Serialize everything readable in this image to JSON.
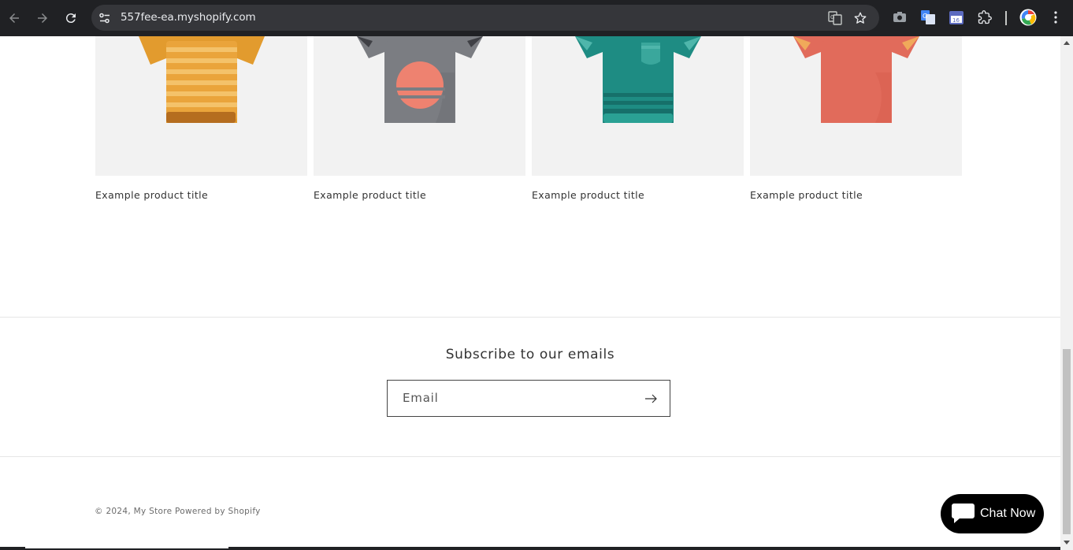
{
  "browser": {
    "url": "557fee-ea.myshopify.com"
  },
  "products": [
    {
      "title": "Example product title",
      "image": "orange-striped-tshirt"
    },
    {
      "title": "Example product title",
      "image": "gray-sunset-tshirt"
    },
    {
      "title": "Example product title",
      "image": "teal-polo-shirt"
    },
    {
      "title": "Example product title",
      "image": "coral-tshirt"
    }
  ],
  "newsletter": {
    "title": "Subscribe to our emails",
    "email_placeholder": "Email"
  },
  "footer": {
    "copyright_prefix": "© 2024,",
    "store_name": "My Store",
    "powered_by": "Powered by Shopify"
  },
  "chat": {
    "label": "Chat Now"
  },
  "colors": {
    "chrome_bg": "#202124",
    "omnibox_bg": "#35363a",
    "card_bg": "#f2f2f2",
    "chat_bg": "#000000"
  }
}
